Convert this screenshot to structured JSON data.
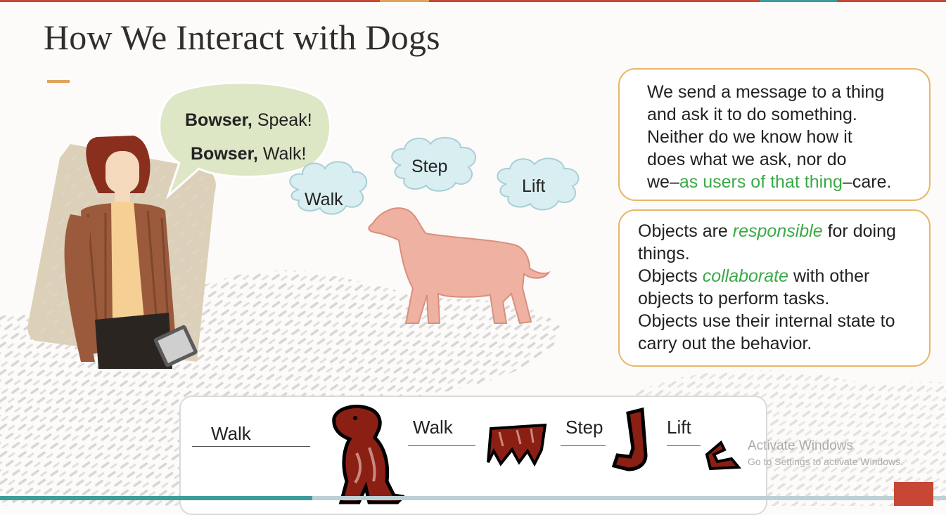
{
  "slide": {
    "title": "How We Interact with Dogs"
  },
  "speech": {
    "line1_name": "Bowser,",
    "line1_cmd": " Speak!",
    "line2_name": "Bowser,",
    "line2_cmd": " Walk!"
  },
  "thoughts": {
    "walk": "Walk",
    "step": "Step",
    "lift": "Lift"
  },
  "box1": {
    "lines": [
      "We send a message to a thing",
      "and ask it to do something.",
      "Neither do we know how it",
      "does what we ask, nor do"
    ],
    "last_prefix": "we–",
    "last_highlight": "as users of that thing",
    "last_suffix": "–care."
  },
  "box2": {
    "p1_prefix": "Objects are ",
    "p1_highlight": "responsible",
    "p1_suffix": " for doing",
    "p1_line2": "things.",
    "p2_prefix": "Objects ",
    "p2_highlight": "collaborate",
    "p2_suffix": " with other",
    "p2_line2": "objects to perform tasks.",
    "p3_line1": "Objects use their internal state to",
    "p3_line2": "carry out the behavior."
  },
  "sequence": {
    "words": [
      "Walk",
      "Walk",
      "Step",
      "Lift"
    ]
  },
  "watermark": {
    "title": "Activate Windows",
    "subtitle": "Go to Settings to activate Windows."
  },
  "player": {
    "progress": 0.33
  },
  "colors": {
    "accent_orange": "#e0a35a",
    "box_border": "#e6b769",
    "highlight_green": "#3aaa47",
    "dog_pink": "#eeb1a2",
    "cloud_blue": "#d9eef1",
    "bubble_green": "#dde6c5",
    "oracle_red": "#c74634"
  }
}
